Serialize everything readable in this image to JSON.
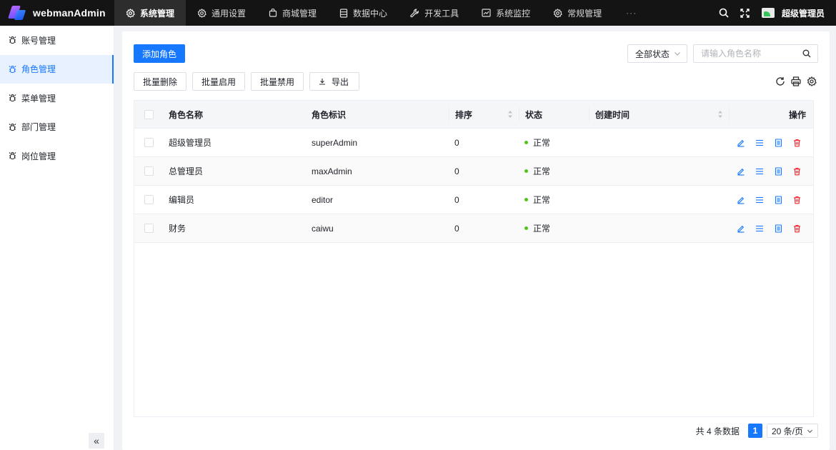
{
  "app": {
    "brand": "webmanAdmin",
    "user": "超级管理员"
  },
  "colors": {
    "primary": "#1677ff",
    "status_ok": "#52c41a",
    "danger": "#f5222d",
    "topbar": "#141414"
  },
  "topnav": [
    {
      "label": "系统管理",
      "icon": "gear-icon",
      "active": true
    },
    {
      "label": "通用设置",
      "icon": "gear-icon"
    },
    {
      "label": "商城管理",
      "icon": "shopping-bag-icon"
    },
    {
      "label": "数据中心",
      "icon": "database-icon"
    },
    {
      "label": "开发工具",
      "icon": "wrench-icon"
    },
    {
      "label": "系统监控",
      "icon": "chart-icon"
    },
    {
      "label": "常规管理",
      "icon": "gear-icon"
    }
  ],
  "topnav_more": "···",
  "sidebar": {
    "items": [
      {
        "label": "账号管理"
      },
      {
        "label": "角色管理",
        "active": true
      },
      {
        "label": "菜单管理"
      },
      {
        "label": "部门管理"
      },
      {
        "label": "岗位管理"
      }
    ],
    "collapse": "«"
  },
  "toolbar": {
    "add_label": "添加角色",
    "status_filter": "全部状态",
    "search_placeholder": "请输入角色名称",
    "batch_delete": "批量删除",
    "batch_enable": "批量启用",
    "batch_disable": "批量禁用",
    "export": "导出"
  },
  "table": {
    "headers": {
      "name": "角色名称",
      "code": "角色标识",
      "sort": "排序",
      "status": "状态",
      "created": "创建时间",
      "ops": "操作"
    },
    "rows": [
      {
        "name": "超级管理员",
        "code": "superAdmin",
        "sort": "0",
        "status": "正常",
        "created": ""
      },
      {
        "name": "总管理员",
        "code": "maxAdmin",
        "sort": "0",
        "status": "正常",
        "created": ""
      },
      {
        "name": "编辑员",
        "code": "editor",
        "sort": "0",
        "status": "正常",
        "created": ""
      },
      {
        "name": "财务",
        "code": "caiwu",
        "sort": "0",
        "status": "正常",
        "created": ""
      }
    ]
  },
  "pagination": {
    "total": "共 4 条数据",
    "page": "1",
    "page_size": "20 条/页"
  }
}
